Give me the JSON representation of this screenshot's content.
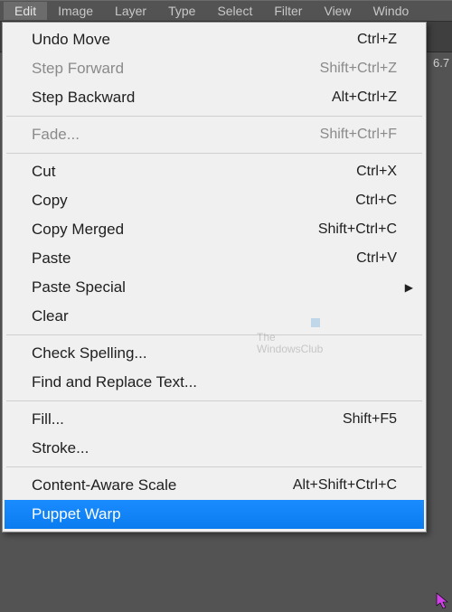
{
  "menubar": {
    "items": [
      {
        "label": "Edit",
        "open": true
      },
      {
        "label": "Image",
        "open": false
      },
      {
        "label": "Layer",
        "open": false
      },
      {
        "label": "Type",
        "open": false
      },
      {
        "label": "Select",
        "open": false
      },
      {
        "label": "Filter",
        "open": false
      },
      {
        "label": "View",
        "open": false
      },
      {
        "label": "Windo",
        "open": false
      }
    ]
  },
  "side_text": "6.7",
  "dropdown": {
    "items": [
      {
        "type": "item",
        "label": "Undo Move",
        "shortcut": "Ctrl+Z",
        "enabled": true,
        "highlight": false,
        "submenu": false
      },
      {
        "type": "item",
        "label": "Step Forward",
        "shortcut": "Shift+Ctrl+Z",
        "enabled": false,
        "highlight": false,
        "submenu": false
      },
      {
        "type": "item",
        "label": "Step Backward",
        "shortcut": "Alt+Ctrl+Z",
        "enabled": true,
        "highlight": false,
        "submenu": false
      },
      {
        "type": "sep"
      },
      {
        "type": "item",
        "label": "Fade...",
        "shortcut": "Shift+Ctrl+F",
        "enabled": false,
        "highlight": false,
        "submenu": false
      },
      {
        "type": "sep"
      },
      {
        "type": "item",
        "label": "Cut",
        "shortcut": "Ctrl+X",
        "enabled": true,
        "highlight": false,
        "submenu": false
      },
      {
        "type": "item",
        "label": "Copy",
        "shortcut": "Ctrl+C",
        "enabled": true,
        "highlight": false,
        "submenu": false
      },
      {
        "type": "item",
        "label": "Copy Merged",
        "shortcut": "Shift+Ctrl+C",
        "enabled": true,
        "highlight": false,
        "submenu": false
      },
      {
        "type": "item",
        "label": "Paste",
        "shortcut": "Ctrl+V",
        "enabled": true,
        "highlight": false,
        "submenu": false
      },
      {
        "type": "item",
        "label": "Paste Special",
        "shortcut": "",
        "enabled": true,
        "highlight": false,
        "submenu": true
      },
      {
        "type": "item",
        "label": "Clear",
        "shortcut": "",
        "enabled": true,
        "highlight": false,
        "submenu": false
      },
      {
        "type": "sep"
      },
      {
        "type": "item",
        "label": "Check Spelling...",
        "shortcut": "",
        "enabled": true,
        "highlight": false,
        "submenu": false
      },
      {
        "type": "item",
        "label": "Find and Replace Text...",
        "shortcut": "",
        "enabled": true,
        "highlight": false,
        "submenu": false
      },
      {
        "type": "sep"
      },
      {
        "type": "item",
        "label": "Fill...",
        "shortcut": "Shift+F5",
        "enabled": true,
        "highlight": false,
        "submenu": false
      },
      {
        "type": "item",
        "label": "Stroke...",
        "shortcut": "",
        "enabled": true,
        "highlight": false,
        "submenu": false
      },
      {
        "type": "sep"
      },
      {
        "type": "item",
        "label": "Content-Aware Scale",
        "shortcut": "Alt+Shift+Ctrl+C",
        "enabled": true,
        "highlight": false,
        "submenu": false
      },
      {
        "type": "item",
        "label": "Puppet Warp",
        "shortcut": "",
        "enabled": true,
        "highlight": true,
        "submenu": false
      }
    ]
  },
  "watermark": {
    "line1": "The",
    "line2": "WindowsClub"
  }
}
